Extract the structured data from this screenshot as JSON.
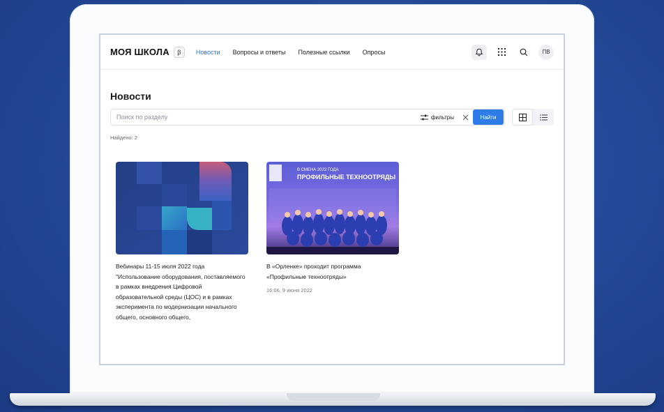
{
  "app": {
    "logo": "МОЯ ШКОЛА",
    "beta": "β"
  },
  "nav": {
    "items": [
      "Новости",
      "Вопросы и ответы",
      "Полезные ссылки",
      "Опросы"
    ],
    "active": "Новости"
  },
  "user": {
    "initials": "ПВ"
  },
  "page": {
    "title": "Новости",
    "search_placeholder": "Поиск по разделу",
    "filters_label": "фильтры",
    "find_label": "Найти",
    "found_text": "Найдено: 2"
  },
  "cards": [
    {
      "title": "Вебинары 11-15 июля 2022 года \"Использование оборудования, поставляемого в рамках внедрения Цифровой образовательной среды (ЦОС) и в рамках эксперимента по модернизации начального общего, основного общего,",
      "date": ""
    },
    {
      "title": "В «Орленке» проходит программа «Профильные техноотряды»",
      "date": "16:06, 9 июня 2022",
      "image_caption_small": "В СМЕНА 2022 ГОДА",
      "image_caption_big": "ПРОФИЛЬНЫЕ ТЕХНООТРЯДЫ"
    }
  ],
  "colors": {
    "accent": "#2f7be8",
    "nav_active": "#2f73d8",
    "background": "#244a9a"
  }
}
